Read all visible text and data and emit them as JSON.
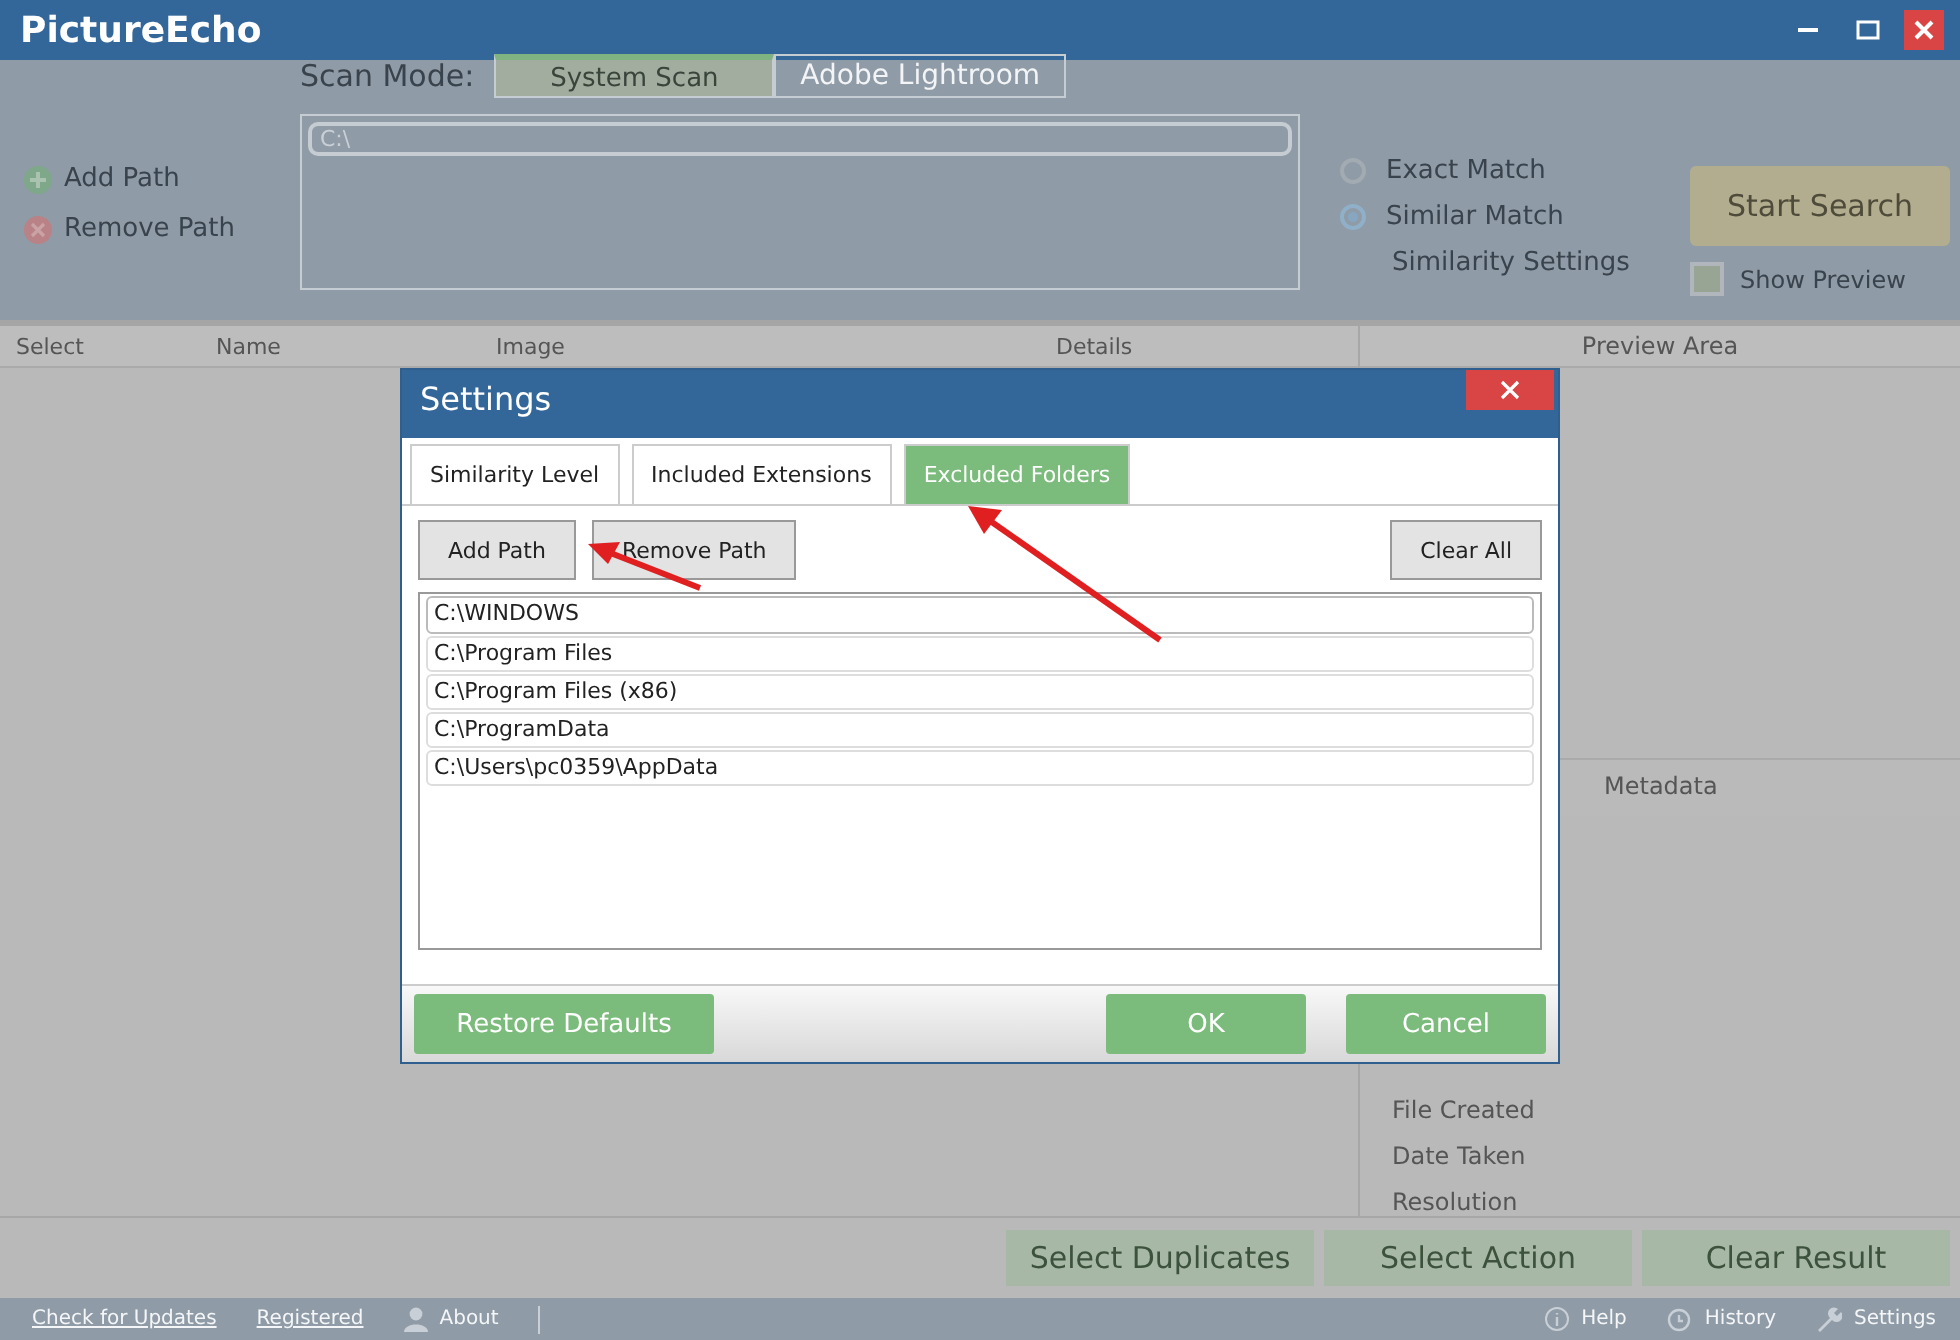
{
  "window": {
    "title": "PictureEcho"
  },
  "scan_mode": {
    "label": "Scan Mode:",
    "tabs": [
      {
        "label": "System Scan",
        "selected": true
      },
      {
        "label": "Adobe Lightroom",
        "selected": false
      }
    ]
  },
  "path_actions": [
    {
      "label": "Add Path",
      "kind": "add"
    },
    {
      "label": "Remove Path",
      "kind": "remove"
    }
  ],
  "scan_paths": [
    "C:\\"
  ],
  "match_options": [
    {
      "label": "Exact Match",
      "selected": false
    },
    {
      "label": "Similar Match",
      "selected": true
    }
  ],
  "similarity_settings": "Similarity Settings",
  "start_search": "Start Search",
  "show_preview": {
    "label": "Show Preview",
    "checked": false
  },
  "table": {
    "columns": [
      "Select",
      "Name",
      "Image",
      "Details"
    ]
  },
  "preview": {
    "title": "Preview Area",
    "metadata_title": "Metadata",
    "fields": [
      "File Created",
      "Date Taken",
      "Resolution"
    ]
  },
  "bottom_buttons": [
    "Select Duplicates",
    "Select Action",
    "Clear Result"
  ],
  "status_bar": {
    "left": [
      {
        "label": "Check for Updates",
        "kind": "link"
      },
      {
        "label": "Registered",
        "kind": "link"
      },
      {
        "label": "About",
        "kind": "user"
      }
    ],
    "right": [
      {
        "label": "Help",
        "kind": "info"
      },
      {
        "label": "History",
        "kind": "history"
      },
      {
        "label": "Settings",
        "kind": "wrench"
      }
    ]
  },
  "dialog": {
    "title": "Settings",
    "tabs": [
      {
        "label": "Similarity Level",
        "selected": false
      },
      {
        "label": "Included Extensions",
        "selected": false
      },
      {
        "label": "Excluded Folders",
        "selected": true
      }
    ],
    "buttons": [
      "Add Path",
      "Remove Path",
      "Clear All"
    ],
    "folders": [
      {
        "path": "C:\\WINDOWS",
        "selected": true
      },
      {
        "path": "C:\\Program Files",
        "selected": false
      },
      {
        "path": "C:\\Program Files (x86)",
        "selected": false
      },
      {
        "path": "C:\\ProgramData",
        "selected": false
      },
      {
        "path": "C:\\Users\\pc0359\\AppData",
        "selected": false
      }
    ],
    "restore": "Restore Defaults",
    "ok": "OK",
    "cancel": "Cancel"
  }
}
